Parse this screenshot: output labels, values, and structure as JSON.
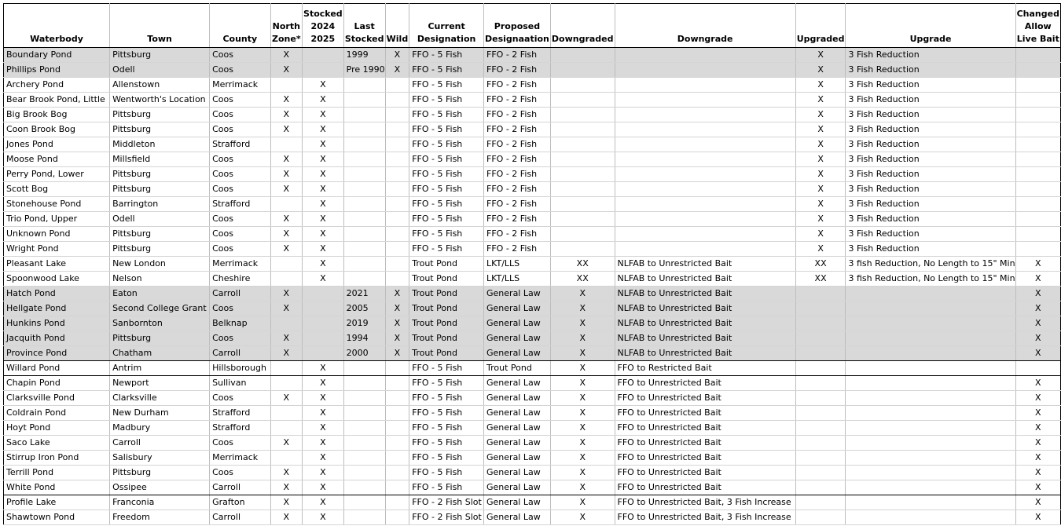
{
  "headers": [
    [
      "Waterbody"
    ],
    [
      "Town"
    ],
    [
      "County"
    ],
    [
      "North",
      "Zone*"
    ],
    [
      "Stocked",
      "2024",
      "2025"
    ],
    [
      "Last",
      "Stocked"
    ],
    [
      "Wild"
    ],
    [
      "Current",
      "Designation"
    ],
    [
      "Proposed",
      "Designaation"
    ],
    [
      "Downgraded"
    ],
    [
      "Downgrade"
    ],
    [
      "Upgraded"
    ],
    [
      "Upgrade"
    ],
    [
      "Changed",
      "Allow",
      "Live Bait"
    ]
  ],
  "rows": [
    {
      "cells": [
        "Boundary Pond",
        "Pittsburg",
        "Coos",
        "X",
        "",
        "1999",
        "X",
        "FFO - 5 Fish",
        "FFO - 2 Fish",
        "",
        "",
        "X",
        "3 Fish Reduction",
        ""
      ],
      "shaded": true
    },
    {
      "cells": [
        "Phillips Pond",
        "Odell",
        "Coos",
        "X",
        "",
        "Pre 1990",
        "X",
        "FFO - 5 Fish",
        "FFO - 2 Fish",
        "",
        "",
        "X",
        "3 Fish Reduction",
        ""
      ],
      "shaded": true
    },
    {
      "cells": [
        "Archery Pond",
        "Allenstown",
        "Merrimack",
        "",
        "X",
        "",
        "",
        "FFO - 5 Fish",
        "FFO - 2 Fish",
        "",
        "",
        "X",
        "3 Fish Reduction",
        ""
      ]
    },
    {
      "cells": [
        "Bear Brook Pond, Little",
        "Wentworth's Location",
        "Coos",
        "X",
        "X",
        "",
        "",
        "FFO - 5 Fish",
        "FFO - 2 Fish",
        "",
        "",
        "X",
        "3 Fish Reduction",
        ""
      ]
    },
    {
      "cells": [
        "Big Brook Bog",
        "Pittsburg",
        "Coos",
        "X",
        "X",
        "",
        "",
        "FFO - 5 Fish",
        "FFO - 2 Fish",
        "",
        "",
        "X",
        "3 Fish Reduction",
        ""
      ]
    },
    {
      "cells": [
        "Coon Brook Bog",
        "Pittsburg",
        "Coos",
        "X",
        "X",
        "",
        "",
        "FFO - 5 Fish",
        "FFO - 2 Fish",
        "",
        "",
        "X",
        "3 Fish Reduction",
        ""
      ]
    },
    {
      "cells": [
        "Jones Pond",
        "Middleton",
        "Strafford",
        "",
        "X",
        "",
        "",
        "FFO - 5 Fish",
        "FFO - 2 Fish",
        "",
        "",
        "X",
        "3 Fish Reduction",
        ""
      ]
    },
    {
      "cells": [
        "Moose Pond",
        "Millsfield",
        "Coos",
        "X",
        "X",
        "",
        "",
        "FFO - 5 Fish",
        "FFO - 2 Fish",
        "",
        "",
        "X",
        "3 Fish Reduction",
        ""
      ]
    },
    {
      "cells": [
        "Perry Pond, Lower",
        "Pittsburg",
        "Coos",
        "X",
        "X",
        "",
        "",
        "FFO - 5 Fish",
        "FFO - 2 Fish",
        "",
        "",
        "X",
        "3 Fish Reduction",
        ""
      ]
    },
    {
      "cells": [
        "Scott Bog",
        "Pittsburg",
        "Coos",
        "X",
        "X",
        "",
        "",
        "FFO - 5 Fish",
        "FFO - 2 Fish",
        "",
        "",
        "X",
        "3 Fish Reduction",
        ""
      ]
    },
    {
      "cells": [
        "Stonehouse Pond",
        "Barrington",
        "Strafford",
        "",
        "X",
        "",
        "",
        "FFO - 5 Fish",
        "FFO - 2 Fish",
        "",
        "",
        "X",
        "3 Fish Reduction",
        ""
      ]
    },
    {
      "cells": [
        "Trio Pond, Upper",
        "Odell",
        "Coos",
        "X",
        "X",
        "",
        "",
        "FFO - 5 Fish",
        "FFO - 2 Fish",
        "",
        "",
        "X",
        "3 Fish Reduction",
        ""
      ]
    },
    {
      "cells": [
        "Unknown Pond",
        "Pittsburg",
        "Coos",
        "X",
        "X",
        "",
        "",
        "FFO - 5 Fish",
        "FFO - 2 Fish",
        "",
        "",
        "X",
        "3 Fish Reduction",
        ""
      ]
    },
    {
      "cells": [
        "Wright Pond",
        "Pittsburg",
        "Coos",
        "X",
        "X",
        "",
        "",
        "FFO - 5 Fish",
        "FFO - 2 Fish",
        "",
        "",
        "X",
        "3 Fish Reduction",
        ""
      ]
    },
    {
      "cells": [
        "Pleasant Lake",
        "New London",
        "Merrimack",
        "",
        "X",
        "",
        "",
        "Trout Pond",
        "LKT/LLS",
        "XX",
        "NLFAB to Unrestricted Bait",
        "XX",
        "3 fish Reduction, No Length to 15\" Min",
        "X"
      ],
      "sep_top": true
    },
    {
      "cells": [
        "Spoonwood Lake",
        "Nelson",
        "Cheshire",
        "",
        "X",
        "",
        "",
        "Trout Pond",
        "LKT/LLS",
        "XX",
        "NLFAB to Unrestricted Bait",
        "XX",
        "3 fish Reduction, No Length to 15\" Min",
        "X"
      ]
    },
    {
      "cells": [
        "Hatch Pond",
        "Eaton",
        "Carroll",
        "X",
        "",
        "2021",
        "X",
        "Trout Pond",
        "General Law",
        "X",
        "NLFAB to Unrestricted Bait",
        "",
        "",
        "X"
      ],
      "shaded": true,
      "sep_top": true
    },
    {
      "cells": [
        "Hellgate Pond",
        "Second College Grant",
        "Coos",
        "X",
        "",
        "2005",
        "X",
        "Trout Pond",
        "General Law",
        "X",
        "NLFAB to Unrestricted Bait",
        "",
        "",
        "X"
      ],
      "shaded": true
    },
    {
      "cells": [
        "Hunkins Pond",
        "Sanbornton",
        "Belknap",
        "",
        "",
        "2019",
        "X",
        "Trout Pond",
        "General Law",
        "X",
        "NLFAB to Unrestricted Bait",
        "",
        "",
        "X"
      ],
      "shaded": true
    },
    {
      "cells": [
        "Jacquith Pond",
        "Pittsburg",
        "Coos",
        "X",
        "",
        "1994",
        "X",
        "Trout Pond",
        "General Law",
        "X",
        "NLFAB to Unrestricted Bait",
        "",
        "",
        "X"
      ],
      "shaded": true
    },
    {
      "cells": [
        "Province Pond",
        "Chatham",
        "Carroll",
        "X",
        "",
        "2000",
        "X",
        "Trout Pond",
        "General Law",
        "X",
        "NLFAB to Unrestricted Bait",
        "",
        "",
        "X"
      ],
      "shaded": true,
      "sep_bottom": true
    },
    {
      "cells": [
        "Willard Pond",
        "Antrim",
        "Hillsborough",
        "",
        "X",
        "",
        "",
        "FFO - 5 Fish",
        "Trout Pond",
        "X",
        "FFO to Restricted Bait",
        "",
        "",
        ""
      ],
      "sep_bottom": true
    },
    {
      "cells": [
        "Chapin Pond",
        "Newport",
        "Sullivan",
        "",
        "X",
        "",
        "",
        "FFO - 5 Fish",
        "General Law",
        "X",
        "FFO to Unrestricted Bait",
        "",
        "",
        "X"
      ]
    },
    {
      "cells": [
        "Clarksville Pond",
        "Clarksville",
        "Coos",
        "X",
        "X",
        "",
        "",
        "FFO - 5 Fish",
        "General Law",
        "X",
        "FFO to Unrestricted Bait",
        "",
        "",
        "X"
      ]
    },
    {
      "cells": [
        "Coldrain Pond",
        "New Durham",
        "Strafford",
        "",
        "X",
        "",
        "",
        "FFO - 5 Fish",
        "General Law",
        "X",
        "FFO to Unrestricted Bait",
        "",
        "",
        "X"
      ]
    },
    {
      "cells": [
        "Hoyt Pond",
        "Madbury",
        "Strafford",
        "",
        "X",
        "",
        "",
        "FFO - 5 Fish",
        "General Law",
        "X",
        "FFO to Unrestricted Bait",
        "",
        "",
        "X"
      ]
    },
    {
      "cells": [
        "Saco Lake",
        "Carroll",
        "Coos",
        "X",
        "X",
        "",
        "",
        "FFO - 5 Fish",
        "General Law",
        "X",
        "FFO to Unrestricted Bait",
        "",
        "",
        "X"
      ]
    },
    {
      "cells": [
        "Stirrup Iron Pond",
        "Salisbury",
        "Merrimack",
        "",
        "X",
        "",
        "",
        "FFO - 5 Fish",
        "General Law",
        "X",
        "FFO to Unrestricted Bait",
        "",
        "",
        "X"
      ]
    },
    {
      "cells": [
        "Terrill Pond",
        "Pittsburg",
        "Coos",
        "X",
        "X",
        "",
        "",
        "FFO - 5 Fish",
        "General Law",
        "X",
        "FFO to Unrestricted Bait",
        "",
        "",
        "X"
      ]
    },
    {
      "cells": [
        "White Pond",
        "Ossipee",
        "Carroll",
        "X",
        "X",
        "",
        "",
        "FFO - 5 Fish",
        "General Law",
        "X",
        "FFO to Unrestricted Bait",
        "",
        "",
        "X"
      ],
      "sep_bottom": true
    },
    {
      "cells": [
        "Profile Lake",
        "Franconia",
        "Grafton",
        "X",
        "X",
        "",
        "",
        "FFO - 2 Fish Slot",
        "General Law",
        "X",
        "FFO to Unrestricted Bait, 3 Fish Increase",
        "",
        "",
        "X"
      ]
    },
    {
      "cells": [
        "Shawtown Pond",
        "Freedom",
        "Carroll",
        "X",
        "X",
        "",
        "",
        "FFO - 2 Fish Slot",
        "General Law",
        "X",
        "FFO to Unrestricted Bait, 3 Fish Increase",
        "",
        "",
        "X"
      ]
    }
  ]
}
